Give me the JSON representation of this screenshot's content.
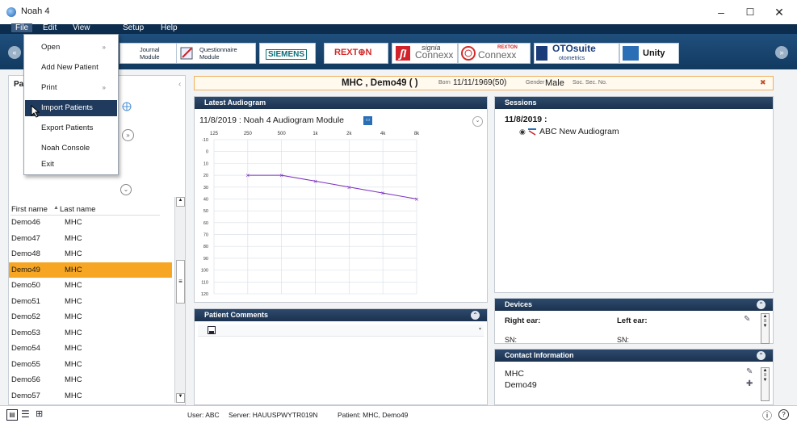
{
  "window": {
    "title": "Noah 4",
    "minimize": "–",
    "maximize": "☐",
    "close": "✕"
  },
  "menu": {
    "file": "File",
    "edit": "Edit",
    "view": "View",
    "setup": "Setup",
    "help": "Help"
  },
  "file_menu": [
    {
      "label": "Open",
      "submenu": true
    },
    {
      "label": "Add New Patient",
      "submenu": false
    },
    {
      "label": "Print",
      "submenu": true
    },
    {
      "label": "Import Patients",
      "submenu": false,
      "highlighted": true
    },
    {
      "label": "Export Patients",
      "submenu": false
    },
    {
      "label": "Noah Console",
      "submenu": false
    },
    {
      "label": "Exit",
      "submenu": false
    }
  ],
  "ribbon": {
    "journal": "Journal\nModule",
    "questionnaire": "Questionnaire\nModule",
    "siemens": "SIEMENS",
    "rexton": "REXT⊕N",
    "signia": "signia",
    "signia_sub": "Connexx",
    "rexton_connexx": "REXTON",
    "rexton_connexx_sub": "Connexx",
    "otosuite": "OTOsuite",
    "otosuite_sub": "otometrics",
    "unity": "Unity",
    "nav_left": "«",
    "nav_right": "»"
  },
  "patient_header": {
    "name": "MHC , Demo49 (  )",
    "born_label": "Born",
    "born_value": "11/11/1969(50)",
    "gender_label": "Gender",
    "gender_value": "Male",
    "ssn_label": "Soc. Sec. No.",
    "close": "✖"
  },
  "left_panel": {
    "title_partial": "Pa",
    "col_first": "First name",
    "col_last": "Last name",
    "sort_icon": "▲",
    "patients": [
      {
        "first": "Demo46",
        "last": "MHC"
      },
      {
        "first": "Demo47",
        "last": "MHC"
      },
      {
        "first": "Demo48",
        "last": "MHC"
      },
      {
        "first": "Demo49",
        "last": "MHC",
        "selected": true
      },
      {
        "first": "Demo50",
        "last": "MHC"
      },
      {
        "first": "Demo51",
        "last": "MHC"
      },
      {
        "first": "Demo52",
        "last": "MHC"
      },
      {
        "first": "Demo53",
        "last": "MHC"
      },
      {
        "first": "Demo54",
        "last": "MHC"
      },
      {
        "first": "Demo55",
        "last": "MHC"
      },
      {
        "first": "Demo56",
        "last": "MHC"
      },
      {
        "first": "Demo57",
        "last": "MHC"
      }
    ]
  },
  "audiogram": {
    "panel_title": "Latest Audiogram",
    "session_line": "11/8/2019 : Noah 4 Audiogram Module",
    "expand": "⌄"
  },
  "chart_data": {
    "type": "line",
    "x": [
      "125",
      "250",
      "500",
      "1k",
      "2k",
      "4k",
      "8k"
    ],
    "xlim_categories": [
      "125",
      "250",
      "500",
      "1k",
      "2k",
      "4k",
      "8k"
    ],
    "y_ticks": [
      "-10",
      "0",
      "10",
      "20",
      "30",
      "40",
      "50",
      "60",
      "70",
      "80",
      "90",
      "100",
      "110",
      "120"
    ],
    "ylim": [
      -10,
      120
    ],
    "y_inverted": true,
    "series": [
      {
        "x": [
          "250",
          "500",
          "1k",
          "2k",
          "4k",
          "8k"
        ],
        "values": [
          20,
          20,
          25,
          30,
          35,
          40
        ],
        "color": "#7b2fbf"
      }
    ],
    "grid": true
  },
  "sessions": {
    "panel_title": "Sessions",
    "date": "11/8/2019 :",
    "item": "ABC New Audiogram"
  },
  "comments": {
    "panel_title": "Patient Comments",
    "save_icon": "floppy"
  },
  "devices": {
    "panel_title": "Devices",
    "right_ear": "Right ear:",
    "left_ear": "Left ear:",
    "sn_right": "SN:",
    "sn_left": "SN:"
  },
  "contact": {
    "panel_title": "Contact Information",
    "line1": "MHC",
    "line2": "Demo49"
  },
  "status": {
    "user": "User: ABC",
    "server": "Server: HAUUSPWYTR019N",
    "patient": "Patient: MHC, Demo49",
    "info": "ⓘ",
    "help": "?"
  },
  "colors": {
    "accent": "#f6a623",
    "header": "#1c3250",
    "menubar": "#0d2d4e",
    "chart_line": "#7b2fbf"
  }
}
